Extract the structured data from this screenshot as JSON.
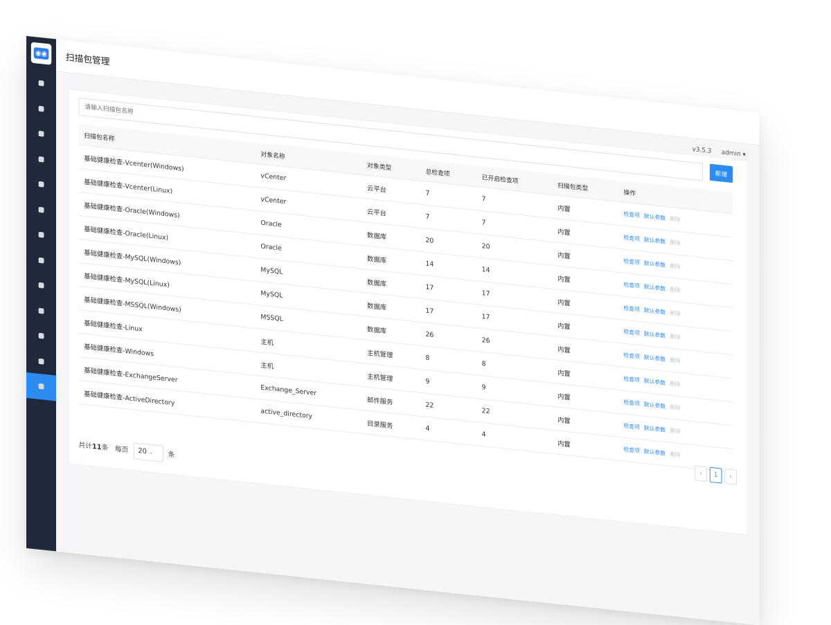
{
  "header": {
    "title": "扫描包管理",
    "version": "v3.5.3",
    "user": "admin ▾"
  },
  "toolbar": {
    "search_placeholder": "请输入扫描包名称",
    "add_label": "新增"
  },
  "table": {
    "columns": [
      "扫描包名称",
      "对象名称",
      "对象类型",
      "总检查项",
      "已开启检查项",
      "扫描包类型",
      "操作"
    ],
    "rows": [
      {
        "name": "基础健康检查-Vcenter(Windows)",
        "object": "vCenter",
        "type": "云平台",
        "total": "7",
        "enabled": "7",
        "pkg_type": "内置",
        "a1": "检查项",
        "a2": "默认参数",
        "a3": "删除"
      },
      {
        "name": "基础健康检查-Vcenter(Linux)",
        "object": "vCenter",
        "type": "云平台",
        "total": "7",
        "enabled": "7",
        "pkg_type": "内置",
        "a1": "检查项",
        "a2": "默认参数",
        "a3": "删除"
      },
      {
        "name": "基础健康检查-Oracle(Windows)",
        "object": "Oracle",
        "type": "数据库",
        "total": "20",
        "enabled": "20",
        "pkg_type": "内置",
        "a1": "检查项",
        "a2": "默认参数",
        "a3": "删除"
      },
      {
        "name": "基础健康检查-Oracle(Linux)",
        "object": "Oracle",
        "type": "数据库",
        "total": "14",
        "enabled": "14",
        "pkg_type": "内置",
        "a1": "检查项",
        "a2": "默认参数",
        "a3": "删除"
      },
      {
        "name": "基础健康检查-MySQL(Windows)",
        "object": "MySQL",
        "type": "数据库",
        "total": "17",
        "enabled": "17",
        "pkg_type": "内置",
        "a1": "检查项",
        "a2": "默认参数",
        "a3": "删除"
      },
      {
        "name": "基础健康检查-MySQL(Linux)",
        "object": "MySQL",
        "type": "数据库",
        "total": "17",
        "enabled": "17",
        "pkg_type": "内置",
        "a1": "检查项",
        "a2": "默认参数",
        "a3": "删除"
      },
      {
        "name": "基础健康检查-MSSQL(Windows)",
        "object": "MSSQL",
        "type": "数据库",
        "total": "26",
        "enabled": "26",
        "pkg_type": "内置",
        "a1": "检查项",
        "a2": "默认参数",
        "a3": "删除"
      },
      {
        "name": "基础健康检查-Linux",
        "object": "主机",
        "type": "主机管理",
        "total": "8",
        "enabled": "8",
        "pkg_type": "内置",
        "a1": "检查项",
        "a2": "默认参数",
        "a3": "删除"
      },
      {
        "name": "基础健康检查-Windows",
        "object": "主机",
        "type": "主机管理",
        "total": "9",
        "enabled": "9",
        "pkg_type": "内置",
        "a1": "检查项",
        "a2": "默认参数",
        "a3": "删除"
      },
      {
        "name": "基础健康检查-ExchangeServer",
        "object": "Exchange_Server",
        "type": "邮件服务",
        "total": "22",
        "enabled": "22",
        "pkg_type": "内置",
        "a1": "检查项",
        "a2": "默认参数",
        "a3": "删除"
      },
      {
        "name": "基础健康检查-ActiveDirectory",
        "object": "active_directory",
        "type": "目录服务",
        "total": "4",
        "enabled": "4",
        "pkg_type": "内置",
        "a1": "检查项",
        "a2": "默认参数",
        "a3": "删除"
      }
    ]
  },
  "footer": {
    "total_prefix": "共计",
    "total": "11",
    "total_unit": "条",
    "per_page_label": "每页",
    "page_size": "20",
    "page_size_unit": "条"
  },
  "pagination": {
    "prev": "‹",
    "current": "1",
    "next": "›"
  },
  "sidebar": {
    "active_index": 12,
    "icons": [
      "home-icon",
      "alarm-icon",
      "apps-icon",
      "monitor-icon",
      "cloud-icon",
      "radar-icon",
      "toolbox-icon",
      "health-icon",
      "layers-icon",
      "chart-icon",
      "document-icon",
      "clipboard-icon",
      "settings-icon"
    ]
  },
  "colors": {
    "sidebar_bg": "#20293a",
    "accent": "#2d8cf0"
  }
}
